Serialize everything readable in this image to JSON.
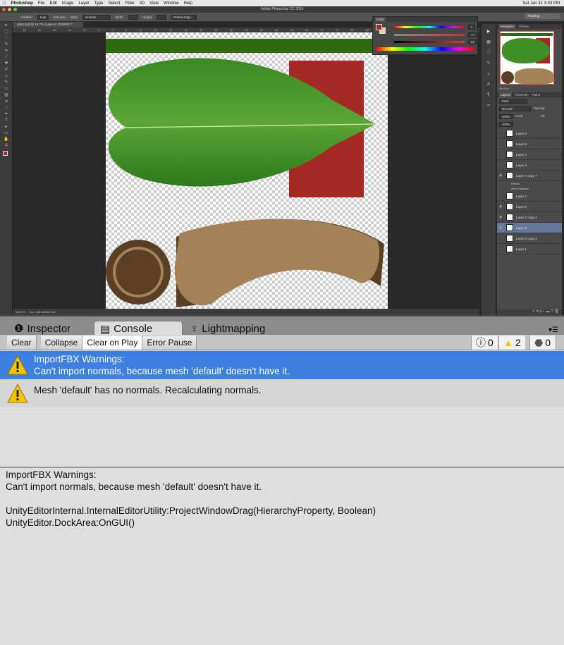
{
  "menubar": {
    "app": "Photoshop",
    "items": [
      "File",
      "Edit",
      "Image",
      "Layer",
      "Type",
      "Select",
      "Filter",
      "3D",
      "View",
      "Window",
      "Help"
    ],
    "clock": "Sat Jan 31  3:03 PM"
  },
  "titlebar": {
    "title": "Adobe Photoshop CC 2014"
  },
  "options": {
    "feather_label": "Feather:",
    "feather_value": "0 px",
    "antialias": "Anti-alias",
    "style_label": "Style:",
    "style_value": "Normal",
    "width_label": "Width:",
    "height_label": "Height:",
    "refine": "Refine Edge..."
  },
  "workspace": "Painting",
  "document": {
    "tab": "plant.psd @ 16.7% (Layer 8, RGB/8#) *",
    "ruler": [
      "30",
      "25",
      "20",
      "15",
      "10",
      "5",
      "0",
      "5",
      "10",
      "15",
      "20",
      "25",
      "30",
      "35",
      "40",
      "45",
      "50",
      "55",
      "60",
      "65",
      "70",
      "75",
      "80",
      "85",
      "90"
    ],
    "zoom": "16.67%",
    "doc_size": "Doc: 108.0M/563.0M"
  },
  "color_panel": {
    "tab": "Color",
    "values": [
      "0",
      "77",
      "66"
    ],
    "foreground": "#a52a25",
    "background": "#e6d28c"
  },
  "navigator": {
    "tabs": [
      "Navigator",
      "History"
    ],
    "zoom": "16.67%"
  },
  "layers": {
    "tabs": [
      "Layers",
      "Channels",
      "Paths"
    ],
    "kind": "Kind",
    "blend": "Normal",
    "opacity_label": "Opacity:",
    "opacity": "100%",
    "lock_label": "Lock:",
    "fill_label": "Fill:",
    "fill": "100%",
    "items": [
      {
        "name": "Layer 0",
        "visible": false
      },
      {
        "name": "Layer 5",
        "visible": false
      },
      {
        "name": "Layer 4",
        "visible": false
      },
      {
        "name": "Layer 3",
        "visible": false
      },
      {
        "name": "Layer 7 copy 7",
        "visible": true,
        "effects": "Effects",
        "effect": "Inner Shadow"
      },
      {
        "name": "Layer 7",
        "visible": false
      },
      {
        "name": "Layer 6",
        "visible": true
      },
      {
        "name": "Layer 2 copy 4",
        "visible": true
      },
      {
        "name": "Layer 8",
        "visible": true,
        "selected": true
      },
      {
        "name": "Layer 2 copy 3",
        "visible": false
      },
      {
        "name": "Layer 1",
        "visible": false
      }
    ]
  },
  "unity": {
    "tabs": [
      {
        "label": "Inspector",
        "icon": "info-icon"
      },
      {
        "label": "Console",
        "icon": "console-icon",
        "active": true
      },
      {
        "label": "Lightmapping",
        "icon": "lightbulb-icon"
      }
    ],
    "toolbar": {
      "clear": "Clear",
      "collapse": "Collapse",
      "clear_on_play": "Clear on Play",
      "error_pause": "Error Pause",
      "info_count": "0",
      "warning_count": "2",
      "error_count": "0"
    },
    "entries": [
      {
        "line1": "ImportFBX Warnings:",
        "line2": "Can't import normals, because mesh 'default' doesn't have it.",
        "selected": true
      },
      {
        "line1": "Mesh 'default' has no normals. Recalculating normals."
      }
    ],
    "detail": [
      "ImportFBX Warnings:",
      "Can't import normals, because mesh 'default' doesn't have it.",
      "",
      "UnityEditorInternal.InternalEditorUtility:ProjectWindowDrag(HierarchyProperty, Boolean)",
      "UnityEditor.DockArea:OnGUI()"
    ],
    "colors": {
      "selection": "#3d80df",
      "warning": "#f5c400"
    }
  }
}
